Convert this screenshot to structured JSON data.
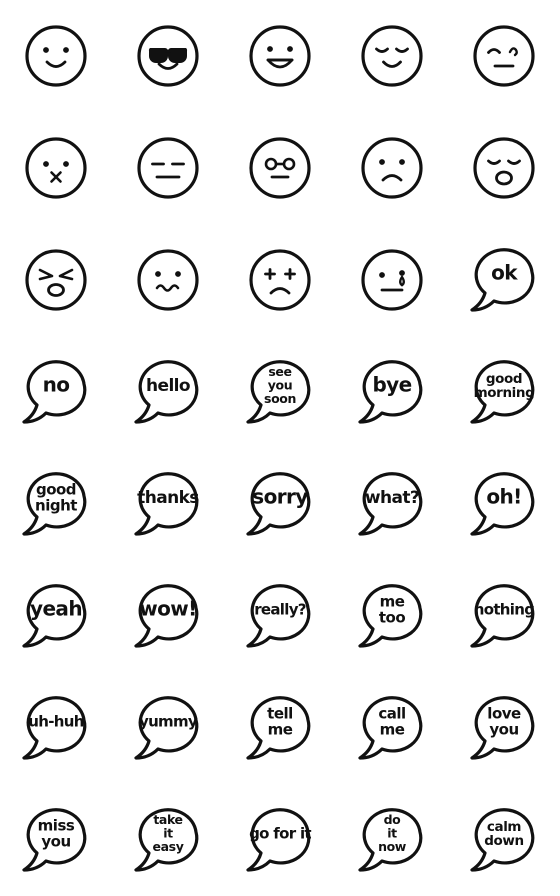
{
  "sheet": {
    "title": "Emoji Sticker Sheet",
    "background_color": "#ffffff",
    "stroke_color": "#111111",
    "columns": 5,
    "rows": 8,
    "total_stickers": 40
  },
  "stickers": [
    {
      "index": 1,
      "row": 1,
      "col": 1,
      "kind": "face",
      "name": "smiling-face",
      "text": ""
    },
    {
      "index": 2,
      "row": 1,
      "col": 2,
      "kind": "face",
      "name": "sunglasses-face",
      "text": ""
    },
    {
      "index": 3,
      "row": 1,
      "col": 3,
      "kind": "face",
      "name": "grinning-open-mouth-face",
      "text": ""
    },
    {
      "index": 4,
      "row": 1,
      "col": 4,
      "kind": "face",
      "name": "relieved-closed-eyes-face",
      "text": ""
    },
    {
      "index": 5,
      "row": 1,
      "col": 5,
      "kind": "face",
      "name": "awkward-sweat-face",
      "text": ""
    },
    {
      "index": 6,
      "row": 2,
      "col": 1,
      "kind": "face",
      "name": "sealed-lips-x-mouth-face",
      "text": ""
    },
    {
      "index": 7,
      "row": 2,
      "col": 2,
      "kind": "face",
      "name": "expressionless-face",
      "text": ""
    },
    {
      "index": 8,
      "row": 2,
      "col": 3,
      "kind": "face",
      "name": "nerd-glasses-face",
      "text": ""
    },
    {
      "index": 9,
      "row": 2,
      "col": 4,
      "kind": "face",
      "name": "frowning-sad-face",
      "text": ""
    },
    {
      "index": 10,
      "row": 2,
      "col": 5,
      "kind": "face",
      "name": "sleepy-yawning-face",
      "text": ""
    },
    {
      "index": 11,
      "row": 3,
      "col": 1,
      "kind": "face",
      "name": "angry-shouting-face",
      "text": ""
    },
    {
      "index": 12,
      "row": 3,
      "col": 2,
      "kind": "face",
      "name": "worried-wavy-mouth-face",
      "text": ""
    },
    {
      "index": 13,
      "row": 3,
      "col": 3,
      "kind": "face",
      "name": "dizzy-x-eyes-sad-face",
      "text": ""
    },
    {
      "index": 14,
      "row": 3,
      "col": 4,
      "kind": "face",
      "name": "crying-tear-face",
      "text": ""
    },
    {
      "index": 15,
      "row": 3,
      "col": 5,
      "kind": "bubble",
      "name": "bubble-ok",
      "text": "ok",
      "lines": [
        "ok"
      ],
      "style": "one-line"
    },
    {
      "index": 16,
      "row": 4,
      "col": 1,
      "kind": "bubble",
      "name": "bubble-no",
      "text": "no",
      "lines": [
        "no"
      ],
      "style": "one-line"
    },
    {
      "index": 17,
      "row": 4,
      "col": 2,
      "kind": "bubble",
      "name": "bubble-hello",
      "text": "hello",
      "lines": [
        "hello"
      ],
      "style": "small-one-line"
    },
    {
      "index": 18,
      "row": 4,
      "col": 3,
      "kind": "bubble",
      "name": "bubble-see-you-soon",
      "text": "see you soon",
      "lines": [
        "see",
        "you",
        "soon"
      ],
      "style": "three-line"
    },
    {
      "index": 19,
      "row": 4,
      "col": 4,
      "kind": "bubble",
      "name": "bubble-bye",
      "text": "bye",
      "lines": [
        "bye"
      ],
      "style": "one-line"
    },
    {
      "index": 20,
      "row": 4,
      "col": 5,
      "kind": "bubble",
      "name": "bubble-good-morning",
      "text": "good morning",
      "lines": [
        "good",
        "morning"
      ],
      "style": "two-line-sm"
    },
    {
      "index": 21,
      "row": 5,
      "col": 1,
      "kind": "bubble",
      "name": "bubble-good-night",
      "text": "good night",
      "lines": [
        "good",
        "night"
      ],
      "style": "two-line"
    },
    {
      "index": 22,
      "row": 5,
      "col": 2,
      "kind": "bubble",
      "name": "bubble-thanks",
      "text": "thanks",
      "lines": [
        "thanks"
      ],
      "style": "small-one-line"
    },
    {
      "index": 23,
      "row": 5,
      "col": 3,
      "kind": "bubble",
      "name": "bubble-sorry",
      "text": "sorry",
      "lines": [
        "sorry"
      ],
      "style": "one-line"
    },
    {
      "index": 24,
      "row": 5,
      "col": 4,
      "kind": "bubble",
      "name": "bubble-what",
      "text": "what?",
      "lines": [
        "what?"
      ],
      "style": "small-one-line"
    },
    {
      "index": 25,
      "row": 5,
      "col": 5,
      "kind": "bubble",
      "name": "bubble-oh",
      "text": "oh!",
      "lines": [
        "oh!"
      ],
      "style": "one-line"
    },
    {
      "index": 26,
      "row": 6,
      "col": 1,
      "kind": "bubble",
      "name": "bubble-yeah",
      "text": "yeah",
      "lines": [
        "yeah"
      ],
      "style": "one-line"
    },
    {
      "index": 27,
      "row": 6,
      "col": 2,
      "kind": "bubble",
      "name": "bubble-wow",
      "text": "wow!",
      "lines": [
        "wow!"
      ],
      "style": "one-line"
    },
    {
      "index": 28,
      "row": 6,
      "col": 3,
      "kind": "bubble",
      "name": "bubble-really",
      "text": "really?",
      "lines": [
        "really?"
      ],
      "style": "tiny-one-line"
    },
    {
      "index": 29,
      "row": 6,
      "col": 4,
      "kind": "bubble",
      "name": "bubble-me-too",
      "text": "me too",
      "lines": [
        "me",
        "too"
      ],
      "style": "two-line"
    },
    {
      "index": 30,
      "row": 6,
      "col": 5,
      "kind": "bubble",
      "name": "bubble-nothing",
      "text": "nothing",
      "lines": [
        "nothing"
      ],
      "style": "tiny-one-line"
    },
    {
      "index": 31,
      "row": 7,
      "col": 1,
      "kind": "bubble",
      "name": "bubble-uh-huh",
      "text": "uh-huh",
      "lines": [
        "uh-huh"
      ],
      "style": "tiny-one-line"
    },
    {
      "index": 32,
      "row": 7,
      "col": 2,
      "kind": "bubble",
      "name": "bubble-yummy",
      "text": "yummy",
      "lines": [
        "yummy"
      ],
      "style": "tiny-one-line"
    },
    {
      "index": 33,
      "row": 7,
      "col": 3,
      "kind": "bubble",
      "name": "bubble-tell-me",
      "text": "tell me",
      "lines": [
        "tell",
        "me"
      ],
      "style": "two-line"
    },
    {
      "index": 34,
      "row": 7,
      "col": 4,
      "kind": "bubble",
      "name": "bubble-call-me",
      "text": "call me",
      "lines": [
        "call",
        "me"
      ],
      "style": "two-line"
    },
    {
      "index": 35,
      "row": 7,
      "col": 5,
      "kind": "bubble",
      "name": "bubble-love-you",
      "text": "love you",
      "lines": [
        "love",
        "you"
      ],
      "style": "two-line"
    },
    {
      "index": 36,
      "row": 8,
      "col": 1,
      "kind": "bubble",
      "name": "bubble-miss-you",
      "text": "miss you",
      "lines": [
        "miss",
        "you"
      ],
      "style": "two-line"
    },
    {
      "index": 37,
      "row": 8,
      "col": 2,
      "kind": "bubble",
      "name": "bubble-take-it-easy",
      "text": "take it easy",
      "lines": [
        "take",
        "it",
        "easy"
      ],
      "style": "three-line"
    },
    {
      "index": 38,
      "row": 8,
      "col": 3,
      "kind": "bubble",
      "name": "bubble-go-for-it",
      "text": "go for it",
      "lines": [
        "go for it"
      ],
      "style": "tiny-one-line"
    },
    {
      "index": 39,
      "row": 8,
      "col": 4,
      "kind": "bubble",
      "name": "bubble-do-it-now",
      "text": "do it now",
      "lines": [
        "do",
        "it",
        "now"
      ],
      "style": "three-line"
    },
    {
      "index": 40,
      "row": 8,
      "col": 5,
      "kind": "bubble",
      "name": "bubble-calm-down",
      "text": "calm down",
      "lines": [
        "calm",
        "down"
      ],
      "style": "two-line-sm"
    }
  ]
}
